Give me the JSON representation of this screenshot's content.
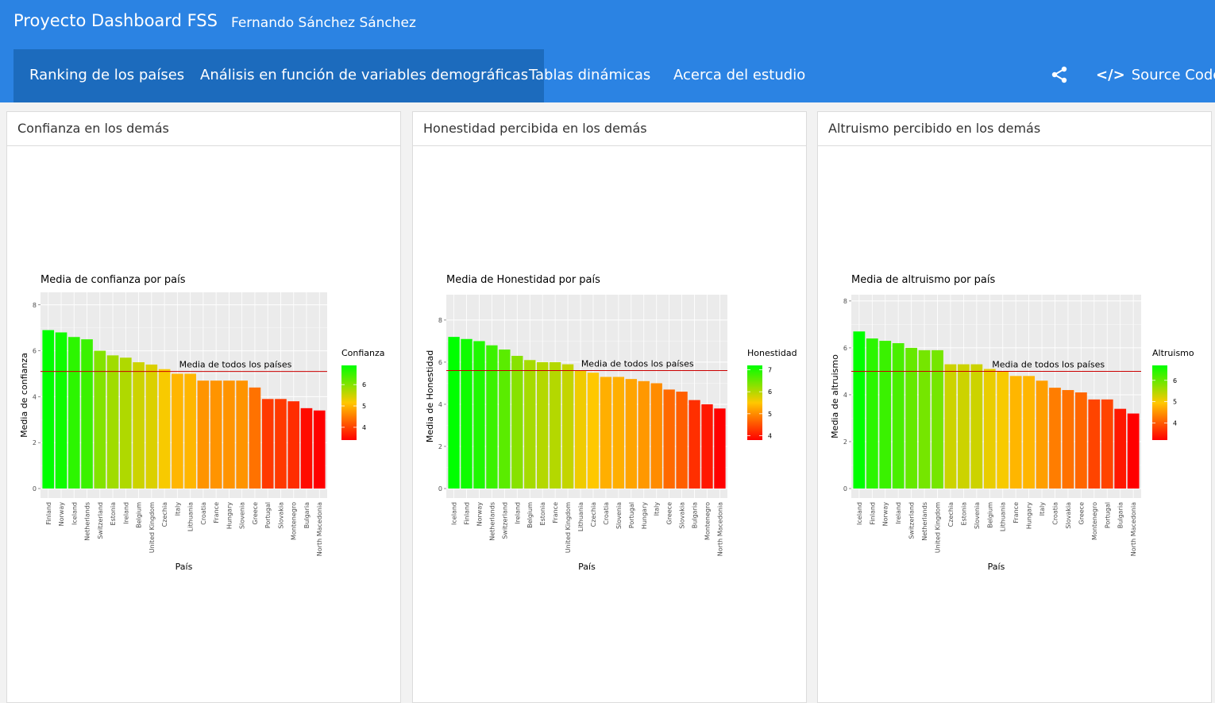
{
  "header": {
    "title": "Proyecto Dashboard FSS",
    "author": "Fernando Sánchez Sánchez"
  },
  "nav": {
    "tabs": [
      {
        "label": "Ranking de los países",
        "active": true
      },
      {
        "label": "Análisis en función de variables demográficas",
        "active": true
      },
      {
        "label": "Tablas dinámicas",
        "active": false
      },
      {
        "label": "Acerca del estudio",
        "active": false
      }
    ],
    "share_icon": "share-icon",
    "source_icon": "code-icon",
    "source_label": "Source Code"
  },
  "colors": {
    "navbar": "#2b83e3",
    "active_tab": "#1c6bbd",
    "bar_high": "#00ff00",
    "bar_low": "#ff0000",
    "mean_line": "#cc0000",
    "panel_bg": "#ebebeb"
  },
  "cards": [
    {
      "header": "Confianza en los demás"
    },
    {
      "header": "Honestidad percibida en los demás"
    },
    {
      "header": "Altruismo percibido en los demás"
    }
  ],
  "chart_data": [
    {
      "type": "bar",
      "title": "Media de confianza por país",
      "xlabel": "País",
      "ylabel": "Media de confianza",
      "legend_title": "Confianza",
      "legend_ticks": [
        4,
        5,
        6
      ],
      "color_range": [
        3.4,
        6.9
      ],
      "ylim": [
        0,
        8.2
      ],
      "yticks": [
        0,
        2,
        4,
        6,
        8
      ],
      "mean_line": 5.1,
      "mean_label": "Media de todos los países",
      "categories": [
        "Finland",
        "Norway",
        "Iceland",
        "Netherlands",
        "Switzerland",
        "Estonia",
        "Ireland",
        "Belgium",
        "United Kingdom",
        "Czechia",
        "Italy",
        "Lithuania",
        "Croatia",
        "France",
        "Hungary",
        "Slovenia",
        "Greece",
        "Portugal",
        "Slovakia",
        "Montenegro",
        "Bulgaria",
        "North Macedonia"
      ],
      "values": [
        6.9,
        6.8,
        6.6,
        6.5,
        6.0,
        5.8,
        5.7,
        5.5,
        5.4,
        5.2,
        5.0,
        5.0,
        4.7,
        4.7,
        4.7,
        4.7,
        4.4,
        3.9,
        3.9,
        3.8,
        3.5,
        3.4
      ],
      "grid": true,
      "legend_position": "right"
    },
    {
      "type": "bar",
      "title": "Media de Honestidad por país",
      "xlabel": "País",
      "ylabel": "Media de Honestidad",
      "legend_title": "Honestidad",
      "legend_ticks": [
        4,
        5,
        6,
        7
      ],
      "color_range": [
        3.8,
        7.2
      ],
      "ylim": [
        0,
        8.6
      ],
      "yticks": [
        0,
        2,
        4,
        6,
        8
      ],
      "mean_line": 5.6,
      "mean_label": "Media de todos los países",
      "categories": [
        "Iceland",
        "Finland",
        "Norway",
        "Netherlands",
        "Switzerland",
        "Ireland",
        "Belgium",
        "Estonia",
        "France",
        "United Kingdom",
        "Lithuania",
        "Czechia",
        "Croatia",
        "Slovenia",
        "Portugal",
        "Hungary",
        "Italy",
        "Greece",
        "Slovakia",
        "Bulgaria",
        "Montenegro",
        "North Macedonia"
      ],
      "values": [
        7.2,
        7.1,
        7.0,
        6.8,
        6.6,
        6.3,
        6.1,
        6.0,
        6.0,
        5.9,
        5.6,
        5.5,
        5.3,
        5.3,
        5.2,
        5.1,
        5.0,
        4.7,
        4.6,
        4.2,
        4.0,
        3.8
      ],
      "grid": true,
      "legend_position": "right"
    },
    {
      "type": "bar",
      "title": "Media de altruismo por país",
      "xlabel": "País",
      "ylabel": "Media de altruismo",
      "legend_title": "Altruismo",
      "legend_ticks": [
        4,
        5,
        6
      ],
      "color_range": [
        3.2,
        6.7
      ],
      "ylim": [
        0,
        8.2
      ],
      "yticks": [
        0,
        2,
        4,
        6,
        8
      ],
      "mean_line": 5.0,
      "mean_label": "Media de todos los países",
      "categories": [
        "Iceland",
        "Finland",
        "Norway",
        "Ireland",
        "Switzerland",
        "Netherlands",
        "United Kingdom",
        "Czechia",
        "Estonia",
        "Slovenia",
        "Belgium",
        "Lithuania",
        "France",
        "Hungary",
        "Italy",
        "Croatia",
        "Slovakia",
        "Greece",
        "Montenegro",
        "Portugal",
        "Bulgaria",
        "North Macedonia"
      ],
      "values": [
        6.7,
        6.4,
        6.3,
        6.2,
        6.0,
        5.9,
        5.9,
        5.3,
        5.3,
        5.3,
        5.1,
        5.0,
        4.8,
        4.8,
        4.6,
        4.3,
        4.2,
        4.1,
        3.8,
        3.8,
        3.4,
        3.2
      ],
      "grid": true,
      "legend_position": "right"
    }
  ]
}
